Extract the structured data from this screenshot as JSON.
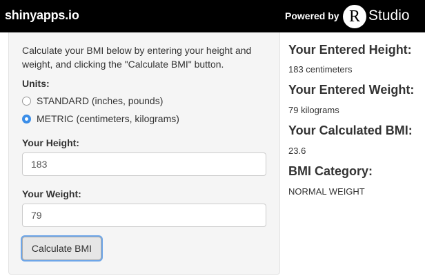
{
  "header": {
    "brand": "shinyapps.io",
    "powered_by": "Powered by",
    "logo_letter": "R",
    "logo_word": "Studio"
  },
  "form": {
    "intro": "Calculate your BMI below by entering your height and weight, and clicking the \"Calculate BMI\" button.",
    "units_label": "Units:",
    "units_options": [
      {
        "label": "STANDARD (inches, pounds)",
        "checked": false
      },
      {
        "label": "METRIC (centimeters, kilograms)",
        "checked": true
      }
    ],
    "height_label": "Your Height:",
    "height_value": "183",
    "weight_label": "Your Weight:",
    "weight_value": "79",
    "button_label": "Calculate BMI"
  },
  "results": {
    "height_heading": "Your Entered Height:",
    "height_value": "183 centimeters",
    "weight_heading": "Your Entered Weight:",
    "weight_value": "79 kilograms",
    "bmi_heading": "Your Calculated BMI:",
    "bmi_value": "23.6",
    "category_heading": "BMI Category:",
    "category_value": "NORMAL WEIGHT"
  },
  "colors": {
    "header_bg": "#000000",
    "panel_bg": "#f5f5f5",
    "radio_checked": "#3b8ee8",
    "button_focus_ring": "#6ea6e8"
  }
}
